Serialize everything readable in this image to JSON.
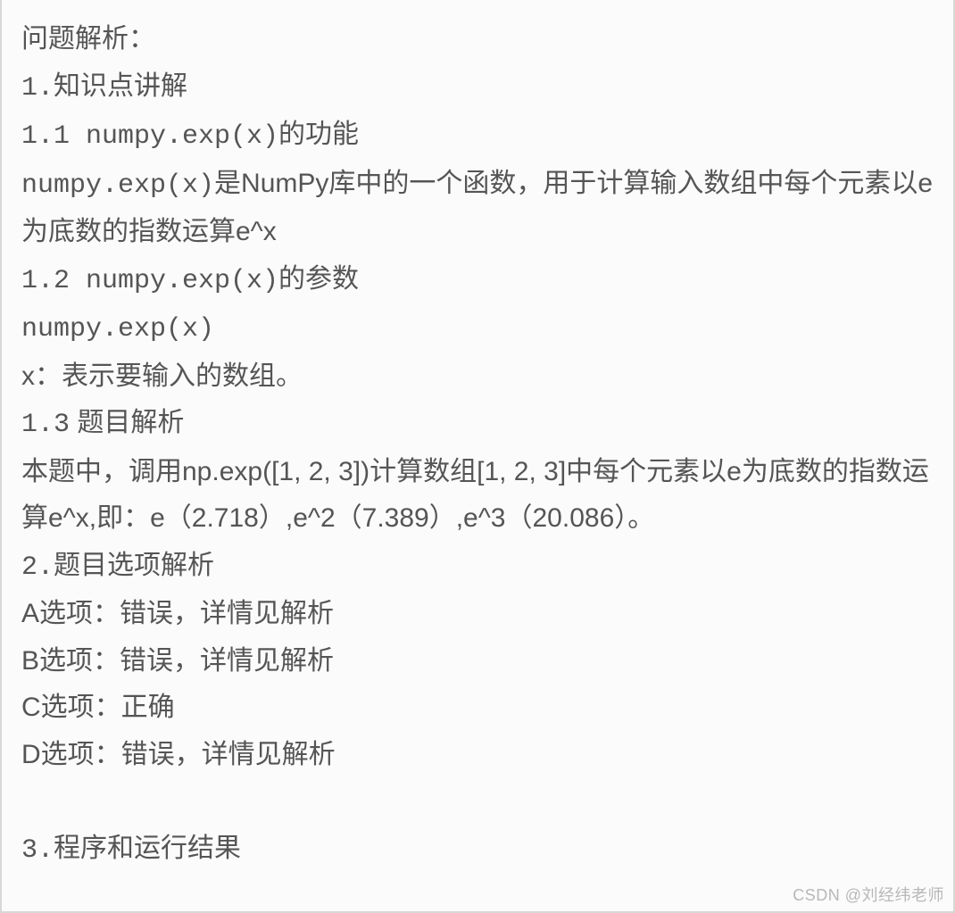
{
  "lines": {
    "l1": "问题解析：",
    "l2_a": "1.",
    "l2_b": "知识点讲解",
    "l3_a": "1.1 numpy.exp(x)",
    "l3_b": "的功能",
    "l4_a": "numpy.exp(x)",
    "l4_b": "是NumPy库中的一个函数，用于计算输入数组中每个元素以e为底数的指数运算e^x",
    "l6_a": "1.2 numpy.exp(x)",
    "l6_b": "的参数",
    "l7": "numpy.exp(x)",
    "l8": "x：表示要输入的数组。",
    "l9_a": "1.3",
    "l9_b": " 题目解析",
    "l10": "本题中，调用np.exp([1, 2, 3])计算数组[1, 2, 3]中每个元素以e为底数的指数运算e^x,即：e（2.718）,e^2（7.389）,e^3（20.086）。",
    "l13_a": "2.",
    "l13_b": "题目选项解析",
    "l14": "A选项：错误，详情见解析",
    "l15": "B选项：错误，详情见解析",
    "l16": "C选项：正确",
    "l17": "D选项：错误，详情见解析",
    "l19_a": "3.",
    "l19_b": "程序和运行结果"
  },
  "watermark": "CSDN @刘经纬老师"
}
